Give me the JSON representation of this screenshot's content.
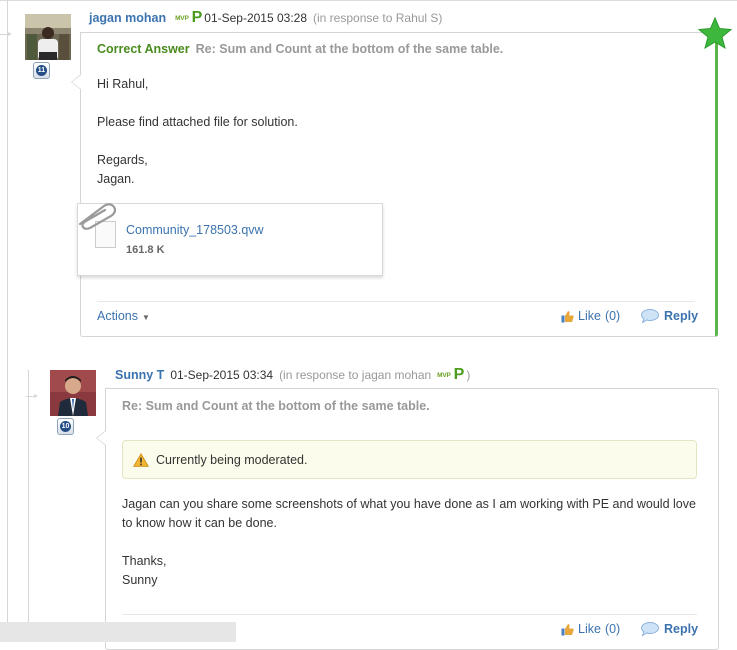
{
  "posts": [
    {
      "author": "jagan mohan",
      "mvp_badge": "MVP",
      "partner_badge": "P",
      "date": "01-Sep-2015 03:28",
      "in_response": "(in response to Rahul S)",
      "level": "11",
      "correct_label": "Correct Answer",
      "subject": "Re: Sum and Count at the bottom of the same table.",
      "body": [
        "Hi Rahul,",
        "Please find attached file for solution.",
        "Regards,",
        "Jagan."
      ],
      "attachment": {
        "name": "Community_178503.qvw",
        "size": "161.8 K"
      },
      "actions_label": "Actions",
      "like_label": "Like",
      "like_count": "(0)",
      "reply_label": "Reply",
      "correct_star_color": "#3db83d"
    },
    {
      "author": "Sunny T",
      "date": "01-Sep-2015 03:34",
      "in_response": "(in response to jagan mohan",
      "in_response_mvp": "MVP",
      "in_response_partner": "P",
      "in_response_close": ")",
      "level": "10",
      "subject": "Re: Sum and Count at the bottom of the same table.",
      "moderation": "Currently being moderated.",
      "body": [
        "Jagan can you share some screenshots of what you have done as I am working with PE and would love to know how it can be done.",
        "Thanks,",
        "Sunny"
      ],
      "like_label": "Like",
      "like_count": "(0)",
      "reply_label": "Reply"
    }
  ],
  "colors": {
    "link": "#3b73af",
    "correct_green": "#4a8c1f",
    "accepted_border": "#5ab54a",
    "moderation_bg": "#fcfcec"
  }
}
